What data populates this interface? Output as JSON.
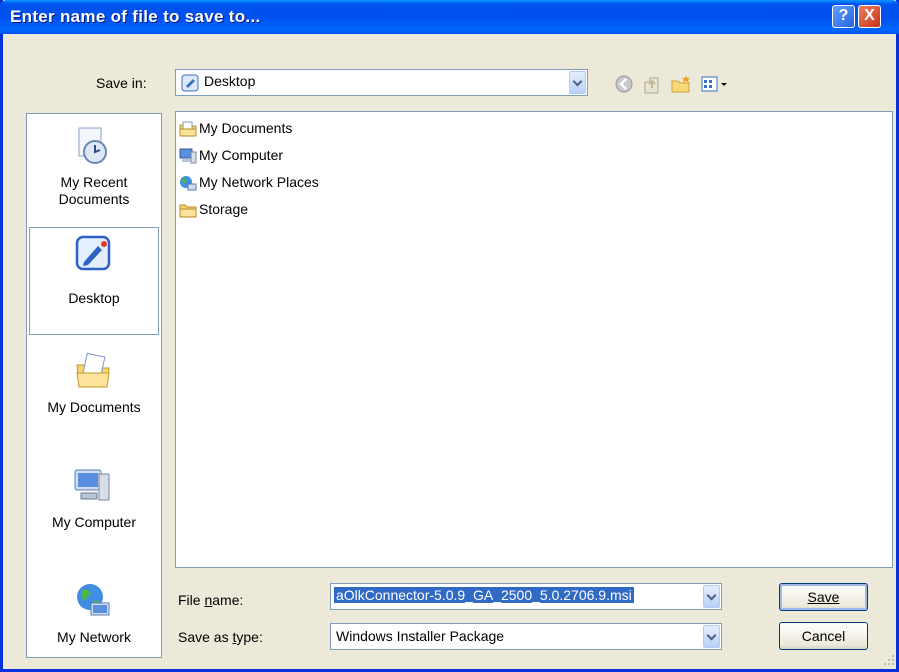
{
  "window": {
    "title": "Enter name of file to save to..."
  },
  "title_buttons": {
    "help": "?",
    "close": "X"
  },
  "save_in": {
    "label": "Save in:",
    "value": "Desktop"
  },
  "places": [
    {
      "label_lines": [
        "My Recent",
        "Documents"
      ],
      "icon": "recent-documents-icon"
    },
    {
      "label_lines": [
        "Desktop"
      ],
      "icon": "desktop-icon",
      "selected": true
    },
    {
      "label_lines": [
        "My Documents"
      ],
      "icon": "my-documents-icon"
    },
    {
      "label_lines": [
        "My Computer"
      ],
      "icon": "my-computer-icon"
    },
    {
      "label_lines": [
        "My Network"
      ],
      "icon": "my-network-icon"
    }
  ],
  "files": [
    {
      "name": "My Documents",
      "icon": "documents-folder-icon"
    },
    {
      "name": "My Computer",
      "icon": "computer-icon"
    },
    {
      "name": "My Network Places",
      "icon": "network-places-icon"
    },
    {
      "name": "Storage",
      "icon": "folder-icon"
    }
  ],
  "file_name": {
    "label": "File name:",
    "value": "aOlkConnector-5.0.9_GA_2500_5.0.2706.9.msi"
  },
  "save_as_type": {
    "label": "Save as type:",
    "value": "Windows Installer Package"
  },
  "buttons": {
    "save": "Save",
    "cancel": "Cancel"
  },
  "colors": {
    "title_bar": "#0050ee",
    "dialog_bg": "#ece9d8",
    "selection": "#316ac5"
  }
}
